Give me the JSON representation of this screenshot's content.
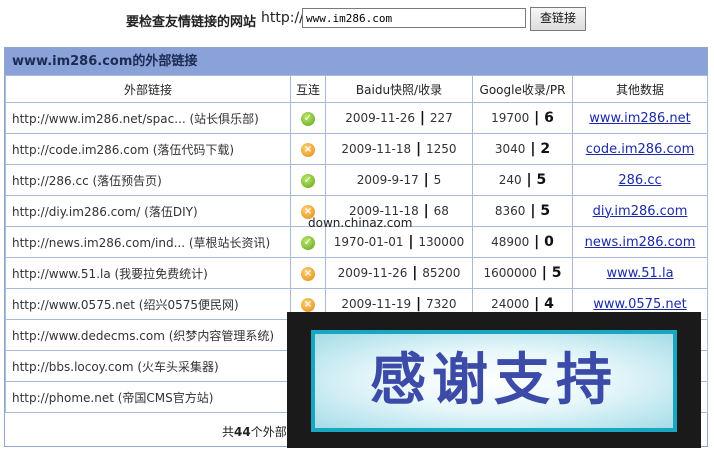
{
  "search": {
    "label": "要检查友情链接的网站",
    "prefix": "http://",
    "url_value": "www.im286.com",
    "check_button": "查链接"
  },
  "panel": {
    "title": "www.im286.com的外部链接"
  },
  "columns": [
    "外部链接",
    "互连",
    "Baidu快照/收录",
    "Google收录/PR",
    "其他数据"
  ],
  "rows": [
    {
      "link": "http://www.im286.net/spac... (站长俱乐部)",
      "status": "ok",
      "baidu_date": "2009-11-26",
      "baidu_count": "227",
      "google_count": "19700",
      "pr": "6",
      "other": "www.im286.net"
    },
    {
      "link": "http://code.im286.com (落伍代码下载)",
      "status": "no",
      "baidu_date": "2009-11-18",
      "baidu_count": "1250",
      "google_count": "3040",
      "pr": "2",
      "other": "code.im286.com"
    },
    {
      "link": "http://286.cc (落伍预告页)",
      "status": "ok",
      "baidu_date": "2009-9-17",
      "baidu_count": "5",
      "google_count": "240",
      "pr": "5",
      "other": "286.cc"
    },
    {
      "link": "http://diy.im286.com/ (落伍DIY)",
      "status": "no",
      "baidu_date": "2009-11-18",
      "baidu_count": "68",
      "google_count": "8360",
      "pr": "5",
      "other": "diy.im286.com"
    },
    {
      "link": "http://news.im286.com/ind... (草根站长资讯)",
      "status": "ok",
      "baidu_date": "1970-01-01",
      "baidu_count": "130000",
      "google_count": "48900",
      "pr": "0",
      "other": "news.im286.com"
    },
    {
      "link": "http://www.51.la (我要拉免费统计)",
      "status": "no",
      "baidu_date": "2009-11-26",
      "baidu_count": "85200",
      "google_count": "1600000",
      "pr": "5",
      "other": "www.51.la"
    },
    {
      "link": "http://www.0575.net (绍兴0575便民网)",
      "status": "no",
      "baidu_date": "2009-11-19",
      "baidu_count": "7320",
      "google_count": "24000",
      "pr": "4",
      "other": "www.0575.net"
    },
    {
      "link": "http://www.dedecms.com (织梦内容管理系统)",
      "status": "",
      "baidu_date": "",
      "baidu_count": "",
      "google_count": "",
      "pr": "",
      "other": ""
    },
    {
      "link": "http://bbs.locoy.com (火车头采集器)",
      "status": "",
      "baidu_date": "",
      "baidu_count": "",
      "google_count": "",
      "pr": "",
      "other": ""
    },
    {
      "link": "http://phome.net (帝国CMS官方站)",
      "status": "",
      "baidu_date": "",
      "baidu_count": "",
      "google_count": "",
      "pr": "",
      "other": ""
    }
  ],
  "footer": {
    "prefix": "共",
    "count": "44",
    "suffix": "个外部"
  },
  "watermark": "down.chinaz.com",
  "overlay": {
    "text": "感谢支持"
  }
}
